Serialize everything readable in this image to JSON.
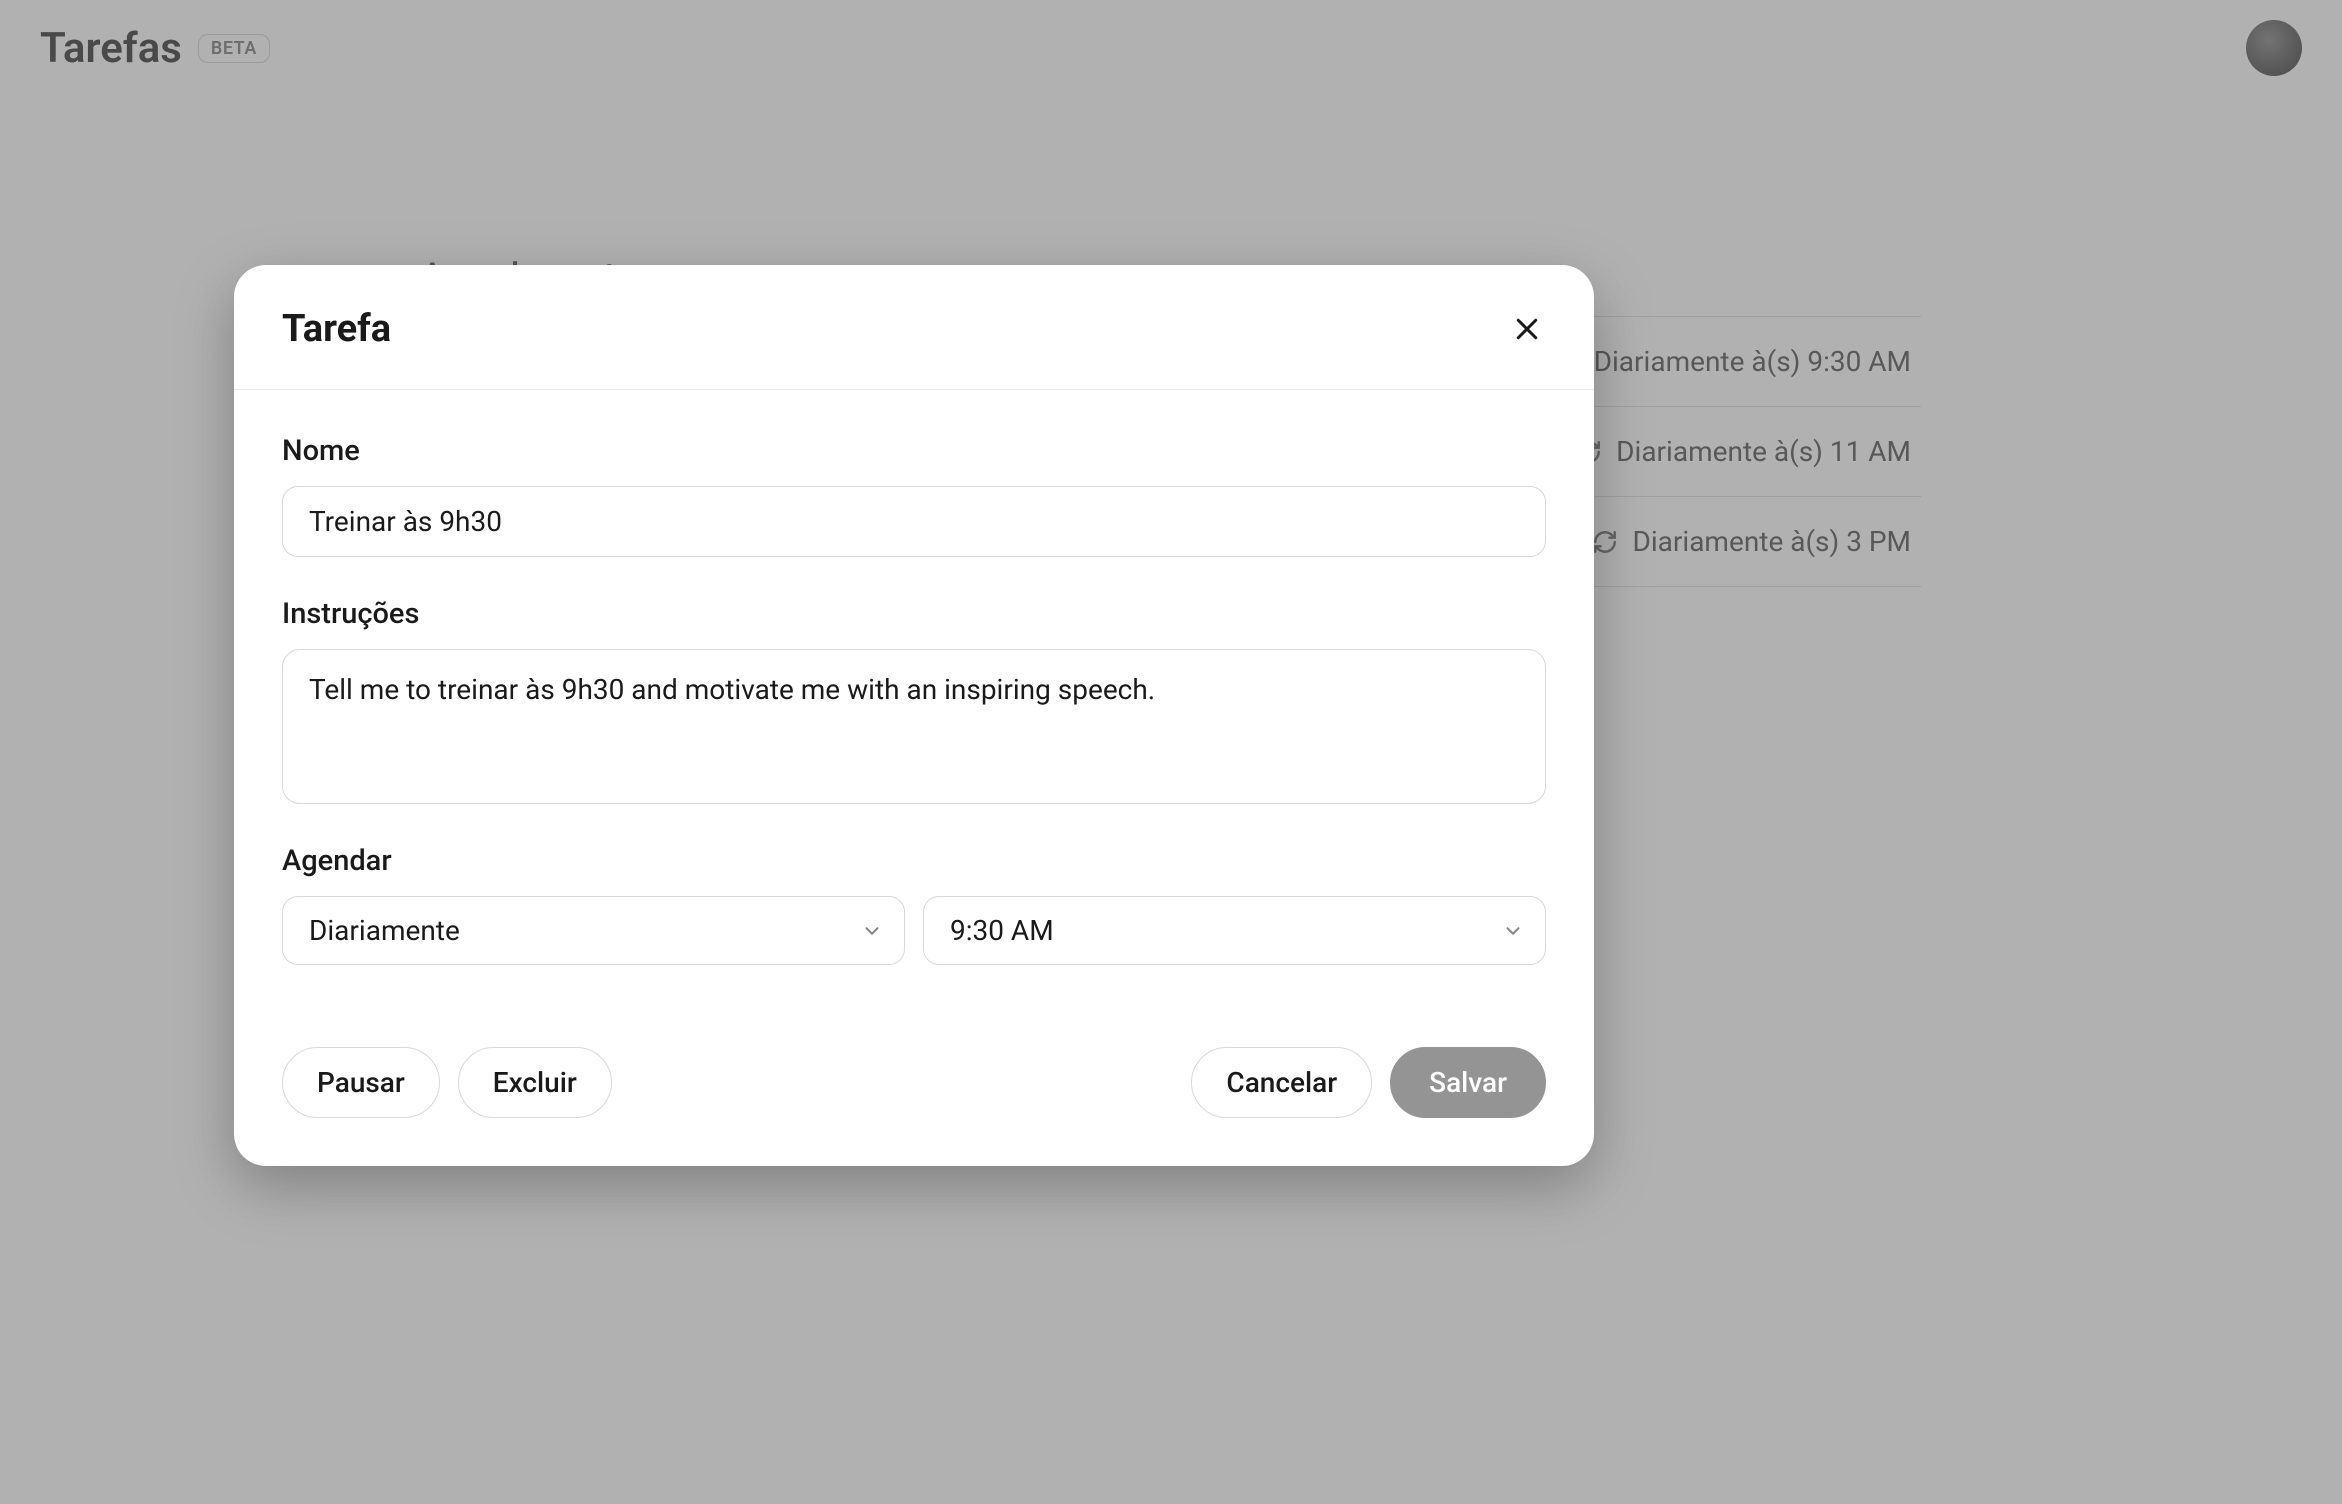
{
  "header": {
    "title": "Tarefas",
    "badge": "BETA"
  },
  "section": {
    "title": "Agendamentos"
  },
  "tasks": [
    {
      "schedule": "Diariamente à(s) 9:30 AM"
    },
    {
      "schedule": "Diariamente à(s) 11 AM"
    },
    {
      "schedule": "Diariamente à(s) 3 PM"
    }
  ],
  "modal": {
    "title": "Tarefa",
    "name_label": "Nome",
    "name_value": "Treinar às 9h30",
    "instructions_label": "Instruções",
    "instructions_value": "Tell me to treinar às 9h30 and motivate me with an inspiring speech.",
    "schedule_label": "Agendar",
    "frequency_value": "Diariamente",
    "time_value": "9:30 AM",
    "pause_label": "Pausar",
    "delete_label": "Excluir",
    "cancel_label": "Cancelar",
    "save_label": "Salvar"
  }
}
